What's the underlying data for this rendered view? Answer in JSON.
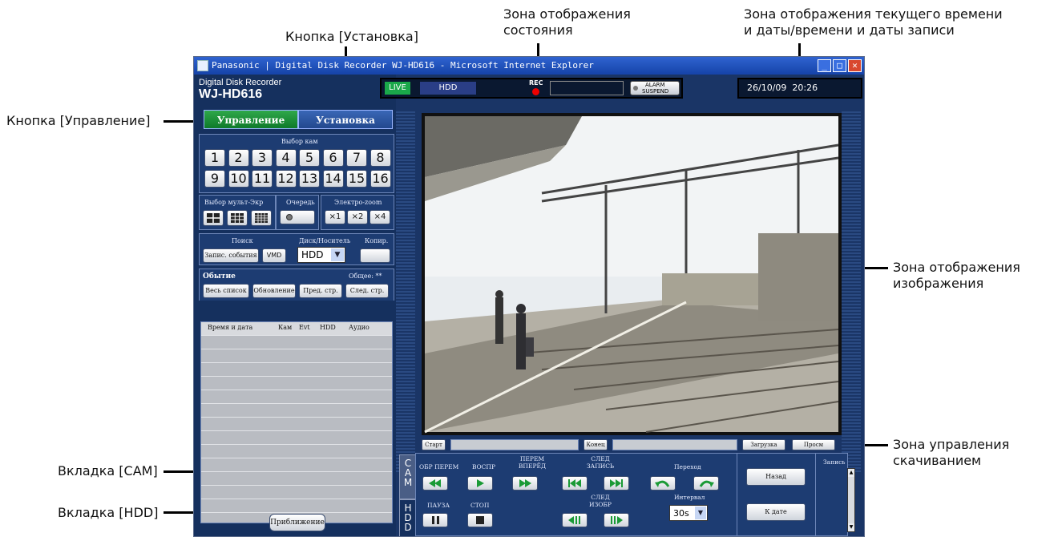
{
  "annotations": {
    "status_zone": "Зона отображения\nсостояния",
    "time_zone": "Зона отображения текущего времени\nи даты/времени и даты записи",
    "setup_button": "Кнопка [Установка]",
    "operation_button": "Кнопка [Управление]",
    "image_zone": "Зона отображения\nизображения",
    "download_zone": "Зона управления\nскачиванием",
    "cam_tab": "Вкладка [CAM]",
    "hdd_tab": "Вкладка [HDD]"
  },
  "window": {
    "title": "Panasonic | Digital Disk Recorder WJ-HD616 - Microsoft Internet Explorer"
  },
  "brand": {
    "line1": "Digital Disk Recorder",
    "line2": "WJ-HD616"
  },
  "tabs": {
    "operation": "Управление",
    "setup": "Установка"
  },
  "camera_select": {
    "label": "Выбор кам",
    "buttons": [
      "1",
      "2",
      "3",
      "4",
      "5",
      "6",
      "7",
      "8",
      "9",
      "10",
      "11",
      "12",
      "13",
      "14",
      "15",
      "16"
    ]
  },
  "multiscreen": {
    "label": "Выбор мульт-Экр"
  },
  "sequence": {
    "label": "Очередь"
  },
  "ezoom": {
    "label": "Электро-zoom",
    "buttons": [
      "×1",
      "×2",
      "×4"
    ]
  },
  "search": {
    "label": "Поиск",
    "event_button": "Запис. события",
    "vmd_button": "VMD"
  },
  "disk": {
    "label": "Диск/Носитель",
    "value": "HDD"
  },
  "copy": {
    "label": "Копир."
  },
  "events": {
    "label": "Обытие",
    "total": "Общее: **",
    "buttons": [
      "Весь список",
      "Обновление",
      "Пред. стр.",
      "След. стр."
    ],
    "columns": [
      "Время и дата",
      "Кам",
      "Evt",
      "HDD",
      "Аудио"
    ]
  },
  "zoom_button": "Приближение",
  "status": {
    "live": "LIVE",
    "hdd": "HDD",
    "rec": "REC",
    "alarm_line1": "ALARM",
    "alarm_line2": "SUSPEND"
  },
  "datetime": "26/10/09  20:26",
  "download": {
    "start": "Старт",
    "end": "Конец",
    "load": "Загрузка",
    "view": "Просм"
  },
  "vtabs": {
    "cam": "CAM",
    "hdd": "HDD"
  },
  "playback": {
    "rev": "ОБР ПЕРЕМ",
    "play": "ВОСПР",
    "ff": "ПЕРЕМ ВПЕРЁД",
    "next_rec": "СЛЕД ЗАПИСЬ",
    "jump": "Переход",
    "pause": "ПАУЗА",
    "stop": "СТОП",
    "next_img": "СЛЕД ИЗОБР",
    "interval_label": "Интервал",
    "interval_value": "30s",
    "back": "Назад",
    "to_date": "К дате",
    "record": "Запись"
  }
}
